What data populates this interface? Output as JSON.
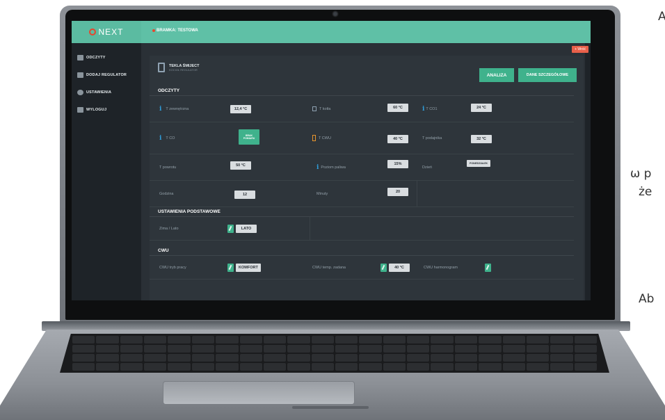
{
  "app": {
    "brand": "NEXT",
    "gateway_label": "BRAMKA: TESTOWA",
    "notification": "+ Wróć"
  },
  "sidebar": {
    "items": [
      {
        "label": "ODCZYTY",
        "icon": "readings-icon"
      },
      {
        "label": "DODAJ REGULATOR",
        "icon": "controller-icon"
      },
      {
        "label": "USTAWIENIA",
        "icon": "gear-icon"
      },
      {
        "label": "WYLOGUJ",
        "icon": "logout-icon"
      }
    ]
  },
  "device": {
    "title": "TEKLA ŚMIJECT",
    "subtitle": "KOCIOŁ REGULATOR"
  },
  "actions": {
    "analiza": "ANALIZA",
    "dane": "DANE SZCZEGÓŁOWE"
  },
  "sections": {
    "odczyty": "ODCZYTY",
    "ustawienia": "USTAWIENIA PODSTAWOWE",
    "cwu": "CWU"
  },
  "readings": {
    "t_zewn_label": "T zewnętrzna",
    "t_zewn_val": "12,4 °C",
    "t_kotla_label": "T kotła",
    "t_kotla_val": "60 °C",
    "t_co1_label": "T CO1",
    "t_co1_val": "24 °C",
    "t_co_label": "T CO",
    "t_co_val_1": "BRAK",
    "t_co_val_2": "POMIARU",
    "t_cwu_label": "T CWU",
    "t_cwu_val": "40 °C",
    "t_podajnika_label": "T podajnika",
    "t_podajnika_val": "32 °C",
    "t_powrotu_label": "T powrotu",
    "t_powrotu_val": "50 °C",
    "poziom_label": "Poziom paliwa",
    "poziom_val": "15%",
    "dzien_label": "Dzień",
    "dzien_val": "PONIEDZIAŁEK",
    "godzina_label": "Godzina",
    "godzina_val": "12",
    "minuty_label": "Minuty",
    "minuty_val": "20"
  },
  "settings": {
    "zima_label": "Zima / Lato",
    "zima_val": "LATO"
  },
  "cwu": {
    "tryb_label": "CWU tryb pracy",
    "tryb_val": "KOMFORT",
    "temp_label": "CWU temp. zadana",
    "temp_val": "40 °C",
    "harm_label": "CWU harmonogram"
  },
  "page_side_text": {
    "line1": "A",
    "line2": "ω p",
    "line3": "że",
    "line4": "Ab"
  }
}
